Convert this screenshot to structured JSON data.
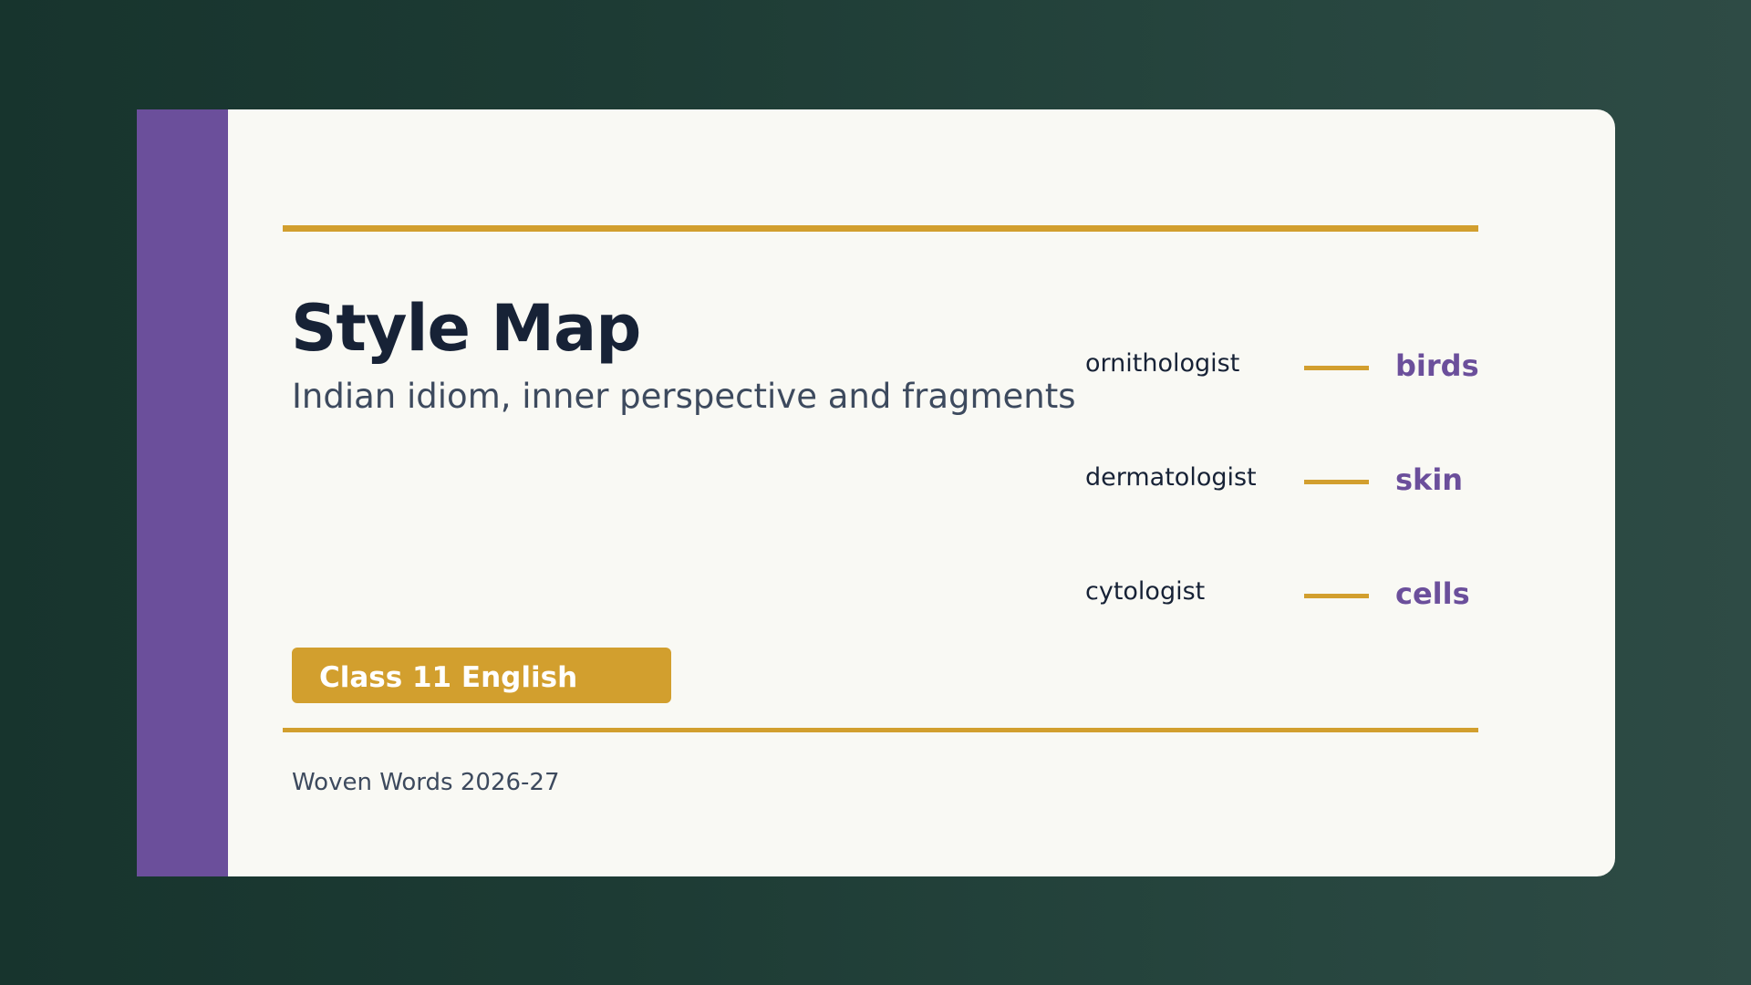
{
  "colors": {
    "accent_gold": "#d29f2e",
    "accent_purple": "#6b4f9b",
    "card_background": "#f9f9f4",
    "title_text": "#172236",
    "body_text": "#3d4a5e"
  },
  "slide": {
    "title": "Style Map",
    "subtitle": "Indian idiom, inner perspective and fragments",
    "badge_label": "Class 11 English",
    "footer": "Woven Words 2026-27",
    "pairs": [
      {
        "term": "ornithologist",
        "meaning": "birds"
      },
      {
        "term": "dermatologist",
        "meaning": "skin"
      },
      {
        "term": "cytologist",
        "meaning": "cells"
      }
    ]
  }
}
